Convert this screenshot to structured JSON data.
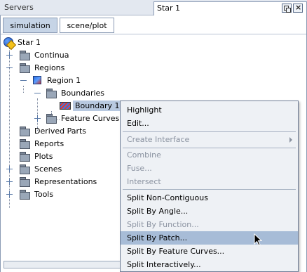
{
  "topbar": {
    "servers_title": "Servers",
    "star_tab_label": "Star 1",
    "restore_icon": "restore-window-icon",
    "close_icon": "close-icon",
    "close_glyph": "×"
  },
  "subtabs": {
    "simulation": "simulation",
    "scene_plot": "scene/plot"
  },
  "tree": {
    "root": "Star 1",
    "continua": "Continua",
    "regions": "Regions",
    "region1": "Region 1",
    "boundaries": "Boundaries",
    "boundary1": "Boundary 1",
    "feature_curves": "Feature Curves",
    "derived_parts": "Derived Parts",
    "reports": "Reports",
    "plots": "Plots",
    "scenes": "Scenes",
    "representations": "Representations",
    "tools": "Tools"
  },
  "context_menu": {
    "highlight": "Highlight",
    "edit": "Edit...",
    "create_interface": "Create Interface",
    "combine": "Combine",
    "fuse": "Fuse...",
    "intersect": "Intersect",
    "split_non_contiguous": "Split Non-Contiguous",
    "split_by_angle": "Split By Angle...",
    "split_by_function": "Split By Function...",
    "split_by_patch": "Split By Patch...",
    "split_by_feature_curves": "Split By Feature Curves...",
    "split_interactively": "Split Interactively..."
  },
  "colors": {
    "selection": "#b8c9e0",
    "menu_hover": "#a7bcd7",
    "active_subtab": "#c6d4e6"
  }
}
